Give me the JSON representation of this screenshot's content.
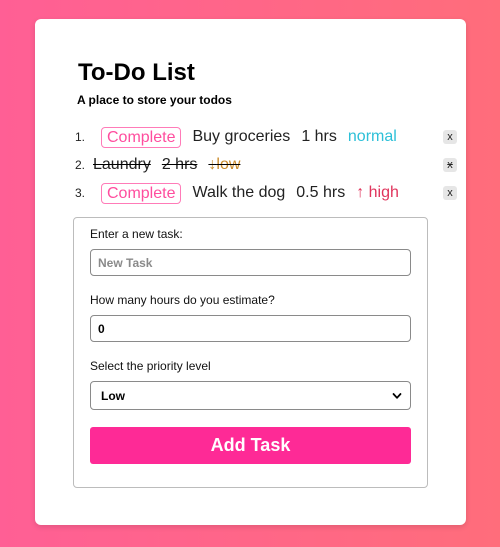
{
  "app": {
    "title": "To-Do List",
    "subtitle": "A place to store your todos"
  },
  "tasks": [
    {
      "number": "1.",
      "completed": false,
      "complete_label": "Complete",
      "text": "Buy groceries",
      "hours": "1 hrs",
      "priority": "normal",
      "priority_label": "normal",
      "priority_arrow": "",
      "delete_label": "x"
    },
    {
      "number": "2.",
      "completed": true,
      "complete_label": "",
      "text": "Laundry",
      "hours": "2 hrs",
      "priority": "low",
      "priority_label": "low",
      "priority_arrow": "↓",
      "delete_label": "x"
    },
    {
      "number": "3.",
      "completed": false,
      "complete_label": "Complete",
      "text": "Walk the dog",
      "hours": "0.5 hrs",
      "priority": "high",
      "priority_label": "high",
      "priority_arrow": "↑",
      "delete_label": "x"
    }
  ],
  "form": {
    "task_label": "Enter a new task:",
    "task_placeholder": "New Task",
    "task_value": "",
    "hours_label": "How many hours do you estimate?",
    "hours_value": "0",
    "priority_label": "Select the priority level",
    "priority_value": "Low",
    "submit_label": "Add Task"
  },
  "icons": {
    "priority_up": "arrow-up-icon",
    "priority_down": "arrow-down-icon",
    "select": "chevron-down-icon"
  },
  "colors": {
    "accent": "#fe2a96",
    "normal": "#2dc0d8",
    "high": "#e0345c",
    "low": "#c98a2a",
    "bg_start": "#ff5f95",
    "bg_end": "#ff6d7b"
  }
}
